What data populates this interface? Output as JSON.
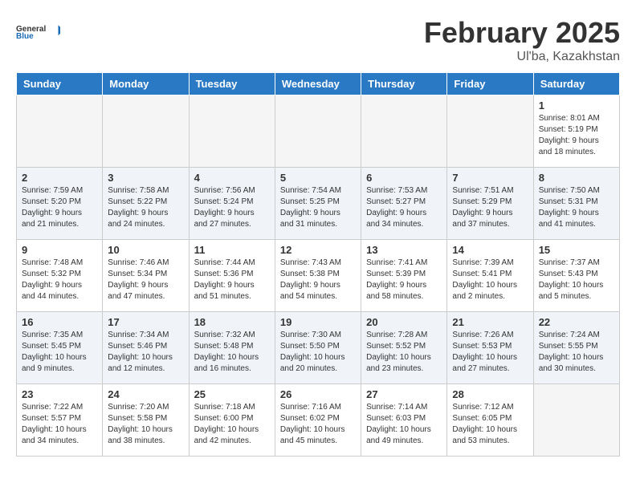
{
  "logo": {
    "line1": "General",
    "line2": "Blue"
  },
  "title": "February 2025",
  "location": "Ul'ba, Kazakhstan",
  "headers": [
    "Sunday",
    "Monday",
    "Tuesday",
    "Wednesday",
    "Thursday",
    "Friday",
    "Saturday"
  ],
  "weeks": [
    [
      {
        "day": "",
        "info": ""
      },
      {
        "day": "",
        "info": ""
      },
      {
        "day": "",
        "info": ""
      },
      {
        "day": "",
        "info": ""
      },
      {
        "day": "",
        "info": ""
      },
      {
        "day": "",
        "info": ""
      },
      {
        "day": "1",
        "info": "Sunrise: 8:01 AM\nSunset: 5:19 PM\nDaylight: 9 hours\nand 18 minutes."
      }
    ],
    [
      {
        "day": "2",
        "info": "Sunrise: 7:59 AM\nSunset: 5:20 PM\nDaylight: 9 hours\nand 21 minutes."
      },
      {
        "day": "3",
        "info": "Sunrise: 7:58 AM\nSunset: 5:22 PM\nDaylight: 9 hours\nand 24 minutes."
      },
      {
        "day": "4",
        "info": "Sunrise: 7:56 AM\nSunset: 5:24 PM\nDaylight: 9 hours\nand 27 minutes."
      },
      {
        "day": "5",
        "info": "Sunrise: 7:54 AM\nSunset: 5:25 PM\nDaylight: 9 hours\nand 31 minutes."
      },
      {
        "day": "6",
        "info": "Sunrise: 7:53 AM\nSunset: 5:27 PM\nDaylight: 9 hours\nand 34 minutes."
      },
      {
        "day": "7",
        "info": "Sunrise: 7:51 AM\nSunset: 5:29 PM\nDaylight: 9 hours\nand 37 minutes."
      },
      {
        "day": "8",
        "info": "Sunrise: 7:50 AM\nSunset: 5:31 PM\nDaylight: 9 hours\nand 41 minutes."
      }
    ],
    [
      {
        "day": "9",
        "info": "Sunrise: 7:48 AM\nSunset: 5:32 PM\nDaylight: 9 hours\nand 44 minutes."
      },
      {
        "day": "10",
        "info": "Sunrise: 7:46 AM\nSunset: 5:34 PM\nDaylight: 9 hours\nand 47 minutes."
      },
      {
        "day": "11",
        "info": "Sunrise: 7:44 AM\nSunset: 5:36 PM\nDaylight: 9 hours\nand 51 minutes."
      },
      {
        "day": "12",
        "info": "Sunrise: 7:43 AM\nSunset: 5:38 PM\nDaylight: 9 hours\nand 54 minutes."
      },
      {
        "day": "13",
        "info": "Sunrise: 7:41 AM\nSunset: 5:39 PM\nDaylight: 9 hours\nand 58 minutes."
      },
      {
        "day": "14",
        "info": "Sunrise: 7:39 AM\nSunset: 5:41 PM\nDaylight: 10 hours\nand 2 minutes."
      },
      {
        "day": "15",
        "info": "Sunrise: 7:37 AM\nSunset: 5:43 PM\nDaylight: 10 hours\nand 5 minutes."
      }
    ],
    [
      {
        "day": "16",
        "info": "Sunrise: 7:35 AM\nSunset: 5:45 PM\nDaylight: 10 hours\nand 9 minutes."
      },
      {
        "day": "17",
        "info": "Sunrise: 7:34 AM\nSunset: 5:46 PM\nDaylight: 10 hours\nand 12 minutes."
      },
      {
        "day": "18",
        "info": "Sunrise: 7:32 AM\nSunset: 5:48 PM\nDaylight: 10 hours\nand 16 minutes."
      },
      {
        "day": "19",
        "info": "Sunrise: 7:30 AM\nSunset: 5:50 PM\nDaylight: 10 hours\nand 20 minutes."
      },
      {
        "day": "20",
        "info": "Sunrise: 7:28 AM\nSunset: 5:52 PM\nDaylight: 10 hours\nand 23 minutes."
      },
      {
        "day": "21",
        "info": "Sunrise: 7:26 AM\nSunset: 5:53 PM\nDaylight: 10 hours\nand 27 minutes."
      },
      {
        "day": "22",
        "info": "Sunrise: 7:24 AM\nSunset: 5:55 PM\nDaylight: 10 hours\nand 30 minutes."
      }
    ],
    [
      {
        "day": "23",
        "info": "Sunrise: 7:22 AM\nSunset: 5:57 PM\nDaylight: 10 hours\nand 34 minutes."
      },
      {
        "day": "24",
        "info": "Sunrise: 7:20 AM\nSunset: 5:58 PM\nDaylight: 10 hours\nand 38 minutes."
      },
      {
        "day": "25",
        "info": "Sunrise: 7:18 AM\nSunset: 6:00 PM\nDaylight: 10 hours\nand 42 minutes."
      },
      {
        "day": "26",
        "info": "Sunrise: 7:16 AM\nSunset: 6:02 PM\nDaylight: 10 hours\nand 45 minutes."
      },
      {
        "day": "27",
        "info": "Sunrise: 7:14 AM\nSunset: 6:03 PM\nDaylight: 10 hours\nand 49 minutes."
      },
      {
        "day": "28",
        "info": "Sunrise: 7:12 AM\nSunset: 6:05 PM\nDaylight: 10 hours\nand 53 minutes."
      },
      {
        "day": "",
        "info": ""
      }
    ]
  ]
}
